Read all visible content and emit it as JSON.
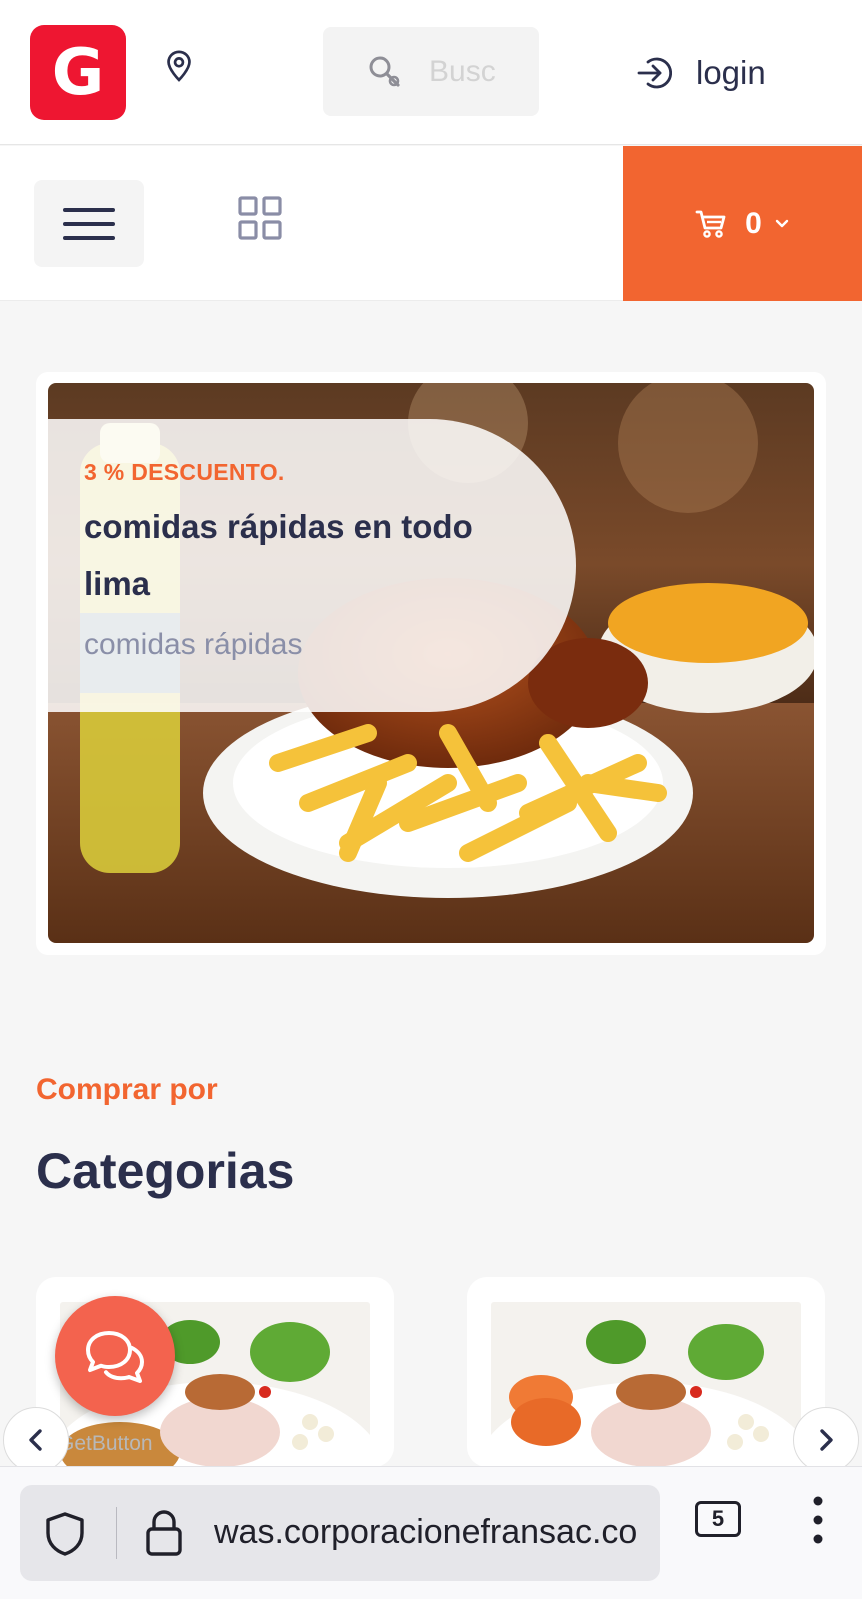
{
  "header": {
    "logo_letter": "G",
    "search_placeholder": "Busc",
    "login_label": "login"
  },
  "navbar": {
    "cart_count": "0"
  },
  "banner": {
    "discount": "3 % DESCUENTO.",
    "title": "comidas rápidas en todo lima",
    "subtitle": "comidas rápidas"
  },
  "categories": {
    "eyebrow": "Comprar por",
    "title": "Categorias"
  },
  "chat_widget": {
    "label": "GetButton"
  },
  "browser": {
    "url": "was.corporacionefransac.co",
    "tab_count": "5"
  },
  "colors": {
    "accent": "#f26530",
    "logo_red": "#ee1631",
    "text_dark": "#2b2f4c",
    "chat": "#f3634e"
  },
  "icons": [
    "location-pin-icon",
    "search-icon",
    "login-icon",
    "menu-icon",
    "grid-icon",
    "cart-icon",
    "chevron-down-icon",
    "chat-icon",
    "chevron-left-icon",
    "chevron-right-icon",
    "shield-icon",
    "lock-icon",
    "more-vertical-icon"
  ]
}
